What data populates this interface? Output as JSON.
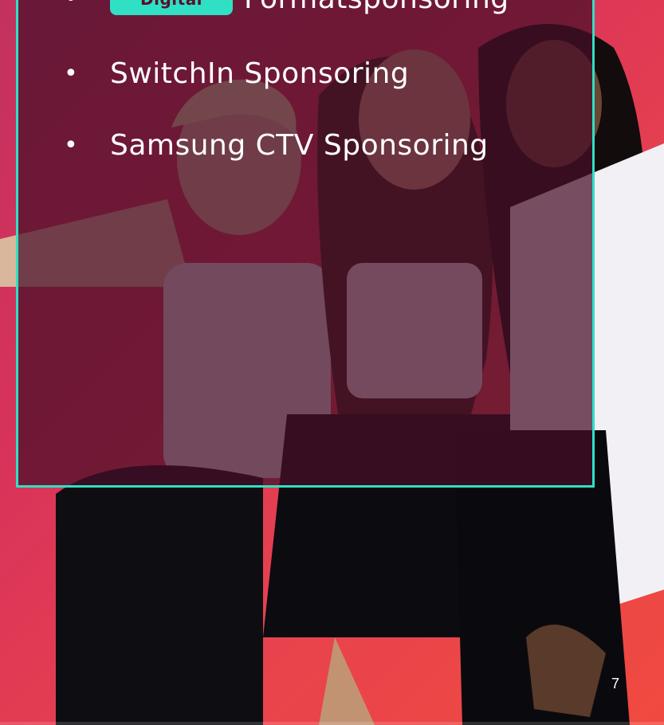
{
  "slide": {
    "bullets": [
      {
        "badge": "Digital",
        "text": "Formatsponsoring"
      },
      {
        "text": "SwitchIn Sponsoring"
      },
      {
        "text": "Samsung CTV Sponsoring"
      }
    ],
    "bullet_symbol": "•",
    "page_number": "7"
  },
  "colors": {
    "accent": "#2fe0c4",
    "gradient_start": "#c2325e",
    "gradient_end": "#f04a40",
    "overlay": "#460e28"
  }
}
